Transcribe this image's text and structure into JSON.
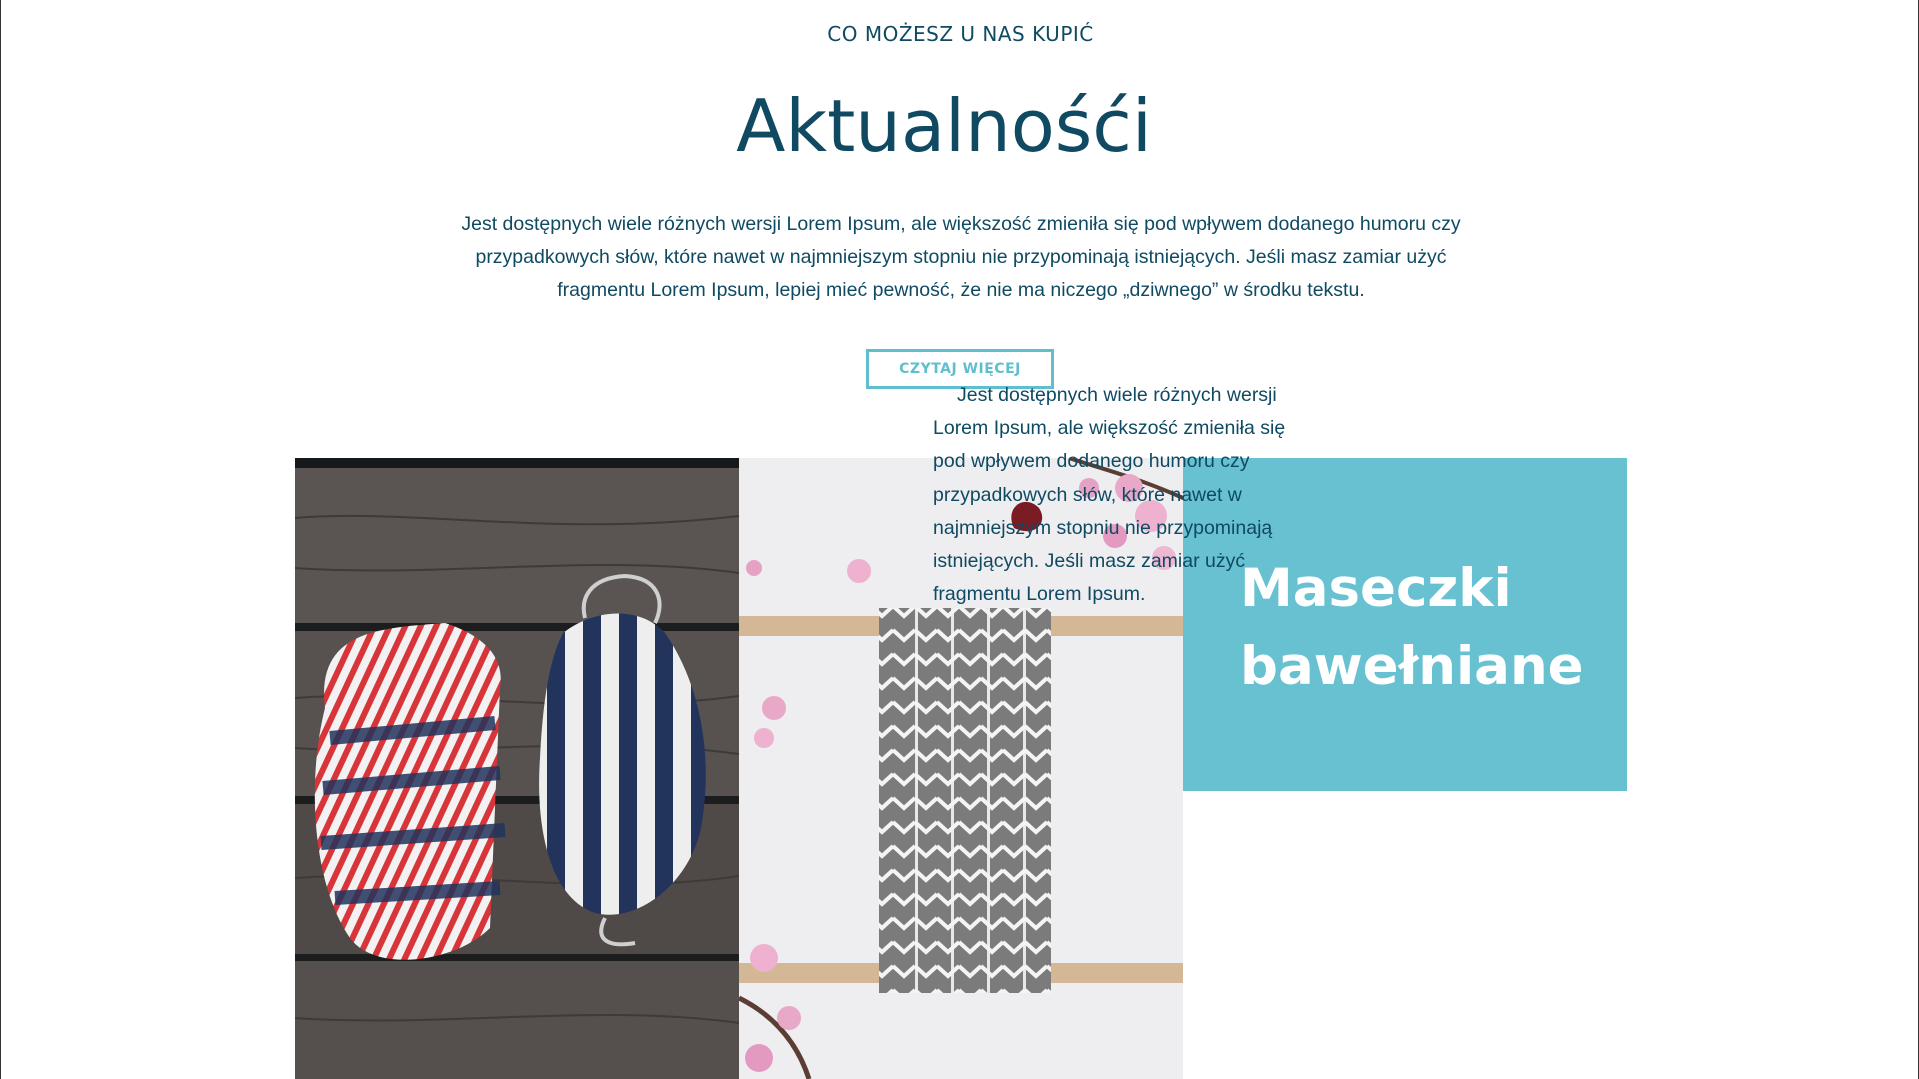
{
  "section": {
    "eyebrow": "CO MOŻESZ U NAS KUPIĆ",
    "title": "Aktualnośći",
    "intro": "Jest dostępnych wiele różnych wersji Lorem Ipsum, ale większość zmieniła się pod wpływem dodanego humoru czy przypadkowych słów, które nawet w najmniejszym stopniu nie przypominają istniejących. Jeśli masz zamiar użyć fragmentu Lorem Ipsum, lepiej mieć pewność, że nie ma niczego „dziwnego” w środku tekstu.",
    "button_label": "CZYTAJ WIĘCEJ"
  },
  "feature": {
    "title": "Maseczki bawełniane",
    "text": "Jest dostępnych wiele różnych wersji Lorem Ipsum, ale większość zmieniła się pod wpływem dodanego humoru czy przypadkowych słów, które nawet w najmniejszym stopniu nie przypominają istniejących. Jeśli masz zamiar użyć fragmentu Lorem Ipsum."
  },
  "colors": {
    "heading": "#0f4a62",
    "accent": "#5fbfcf",
    "feature_background": "#67c1d1"
  }
}
